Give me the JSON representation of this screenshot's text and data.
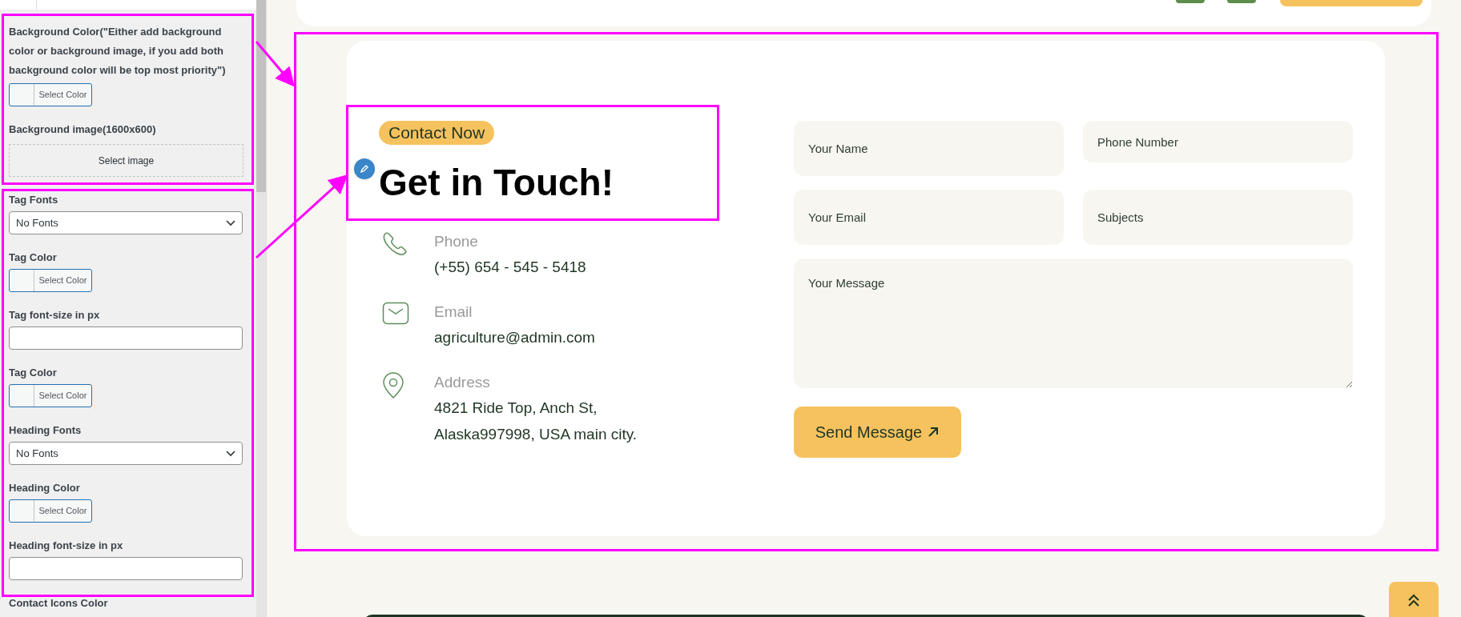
{
  "sidebar": {
    "fields": [
      {
        "kind": "color",
        "label": "Background Color(\"Either add background color or background image, if you add both background color will be top most priority\")",
        "button": "Select Color"
      },
      {
        "kind": "image",
        "label": "Background image(1600x600)",
        "button": "Select image"
      },
      {
        "kind": "select",
        "label": "Tag Fonts",
        "value": "No Fonts"
      },
      {
        "kind": "color",
        "label": "Tag Color",
        "button": "Select Color"
      },
      {
        "kind": "number",
        "label": "Tag font-size in px"
      },
      {
        "kind": "color",
        "label": "Tag Color",
        "button": "Select Color"
      },
      {
        "kind": "select",
        "label": "Heading Fonts",
        "value": "No Fonts"
      },
      {
        "kind": "color",
        "label": "Heading Color",
        "button": "Select Color"
      },
      {
        "kind": "number",
        "label": "Heading font-size in px"
      },
      {
        "kind": "label",
        "label": "Contact Icons Color"
      }
    ]
  },
  "contact": {
    "tag": "Contact Now",
    "heading": "Get in Touch!",
    "items": [
      {
        "kind": "phone",
        "label": "Phone",
        "lines": [
          "(+55) 654 - 545 - 5418"
        ]
      },
      {
        "kind": "email",
        "label": "Email",
        "lines": [
          "agriculture@admin.com"
        ]
      },
      {
        "kind": "address",
        "label": "Address",
        "lines": [
          "4821 Ride Top, Anch St,",
          "Alaska997998, USA main city."
        ]
      }
    ],
    "form": {
      "fields": [
        {
          "kind": "input",
          "placeholder": "Your Name"
        },
        {
          "kind": "input",
          "placeholder": "Phone Number"
        },
        {
          "kind": "input",
          "placeholder": "Your Email"
        },
        {
          "kind": "input",
          "placeholder": "Subjects"
        },
        {
          "kind": "textarea",
          "placeholder": "Your Message"
        }
      ],
      "submit": "Send Message"
    }
  }
}
